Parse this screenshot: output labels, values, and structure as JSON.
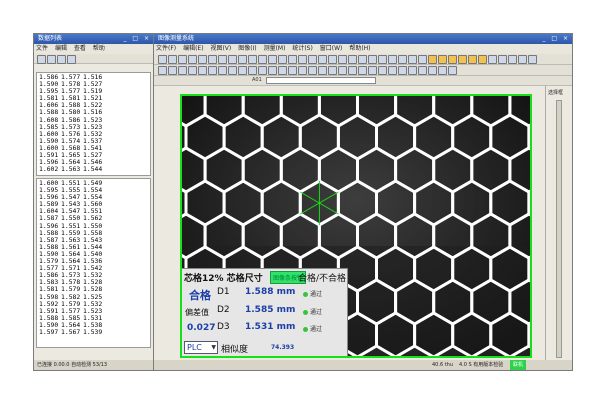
{
  "left_window": {
    "title": "数据列表",
    "window_buttons": "_ □ ×",
    "menu": [
      "文件",
      "编辑",
      "查看",
      "帮助"
    ],
    "upper_rows": [
      [
        "1.586",
        "1.577",
        "1.516"
      ],
      [
        "1.590",
        "1.578",
        "1.527"
      ],
      [
        "1.595",
        "1.577",
        "1.519"
      ],
      [
        "1.581",
        "1.581",
        "1.521"
      ],
      [
        "1.606",
        "1.588",
        "1.522"
      ],
      [
        "1.588",
        "1.580",
        "1.516"
      ],
      [
        "1.608",
        "1.586",
        "1.523"
      ],
      [
        "1.585",
        "1.573",
        "1.523"
      ],
      [
        "1.600",
        "1.576",
        "1.532"
      ],
      [
        "1.590",
        "1.574",
        "1.537"
      ],
      [
        "1.600",
        "1.568",
        "1.541"
      ],
      [
        "1.591",
        "1.565",
        "1.527"
      ],
      [
        "1.596",
        "1.564",
        "1.546"
      ],
      [
        "1.602",
        "1.563",
        "1.544"
      ]
    ],
    "lower_rows": [
      [
        "1.600",
        "1.551",
        "1.549"
      ],
      [
        "1.595",
        "1.555",
        "1.554"
      ],
      [
        "1.596",
        "1.547",
        "1.554"
      ],
      [
        "1.589",
        "1.543",
        "1.560"
      ],
      [
        "1.604",
        "1.547",
        "1.551"
      ],
      [
        "1.587",
        "1.550",
        "1.562"
      ],
      [
        "1.596",
        "1.551",
        "1.550"
      ],
      [
        "1.588",
        "1.559",
        "1.558"
      ],
      [
        "1.587",
        "1.563",
        "1.543"
      ],
      [
        "1.588",
        "1.561",
        "1.544"
      ],
      [
        "1.590",
        "1.564",
        "1.540"
      ],
      [
        "1.579",
        "1.564",
        "1.536"
      ],
      [
        "1.577",
        "1.571",
        "1.542"
      ],
      [
        "1.586",
        "1.573",
        "1.532"
      ],
      [
        "1.583",
        "1.578",
        "1.528"
      ],
      [
        "1.581",
        "1.579",
        "1.528"
      ],
      [
        "1.598",
        "1.582",
        "1.525"
      ],
      [
        "1.592",
        "1.579",
        "1.532"
      ],
      [
        "1.591",
        "1.577",
        "1.523"
      ],
      [
        "1.588",
        "1.585",
        "1.531"
      ],
      [
        "1.590",
        "1.564",
        "1.538"
      ],
      [
        "1.597",
        "1.567",
        "1.539"
      ]
    ],
    "status": "已连接  0.00.0  自动检测  53/13"
  },
  "right_window": {
    "title": "图像测量系统",
    "menu": [
      "文件(F)",
      "编辑(E)",
      "视图(V)",
      "图像(I)",
      "测量(M)",
      "统计(S)",
      "窗口(W)",
      "帮助(H)"
    ],
    "toolbar_text": "A01",
    "status_items": [
      "40.6 thu",
      "4.0 S  有用版本检验",
      "联机"
    ],
    "side_label": "选择框"
  },
  "overlay": {
    "header_left": "芯格12% 芯格尺寸",
    "header_button": "图像条按钮",
    "header_right": "合格/不合格",
    "result": "合格",
    "d1_label": "D1",
    "d1_value": "1.588 mm",
    "d2_label": "D2",
    "d2_value": "1.585 mm",
    "d3_label": "D3",
    "d3_value": "1.531 mm",
    "status_text": "通过",
    "tolerance_label": "偏差值",
    "tolerance_value": "0.027",
    "plc_label": "PLC",
    "similarity_label": "相似度",
    "similarity_value": "74.393"
  },
  "colors": {
    "hex_grid": "#ffffff",
    "highlight": "#18e018",
    "accent_blue": "#1d3ea8",
    "pass_green": "#37c43a"
  }
}
